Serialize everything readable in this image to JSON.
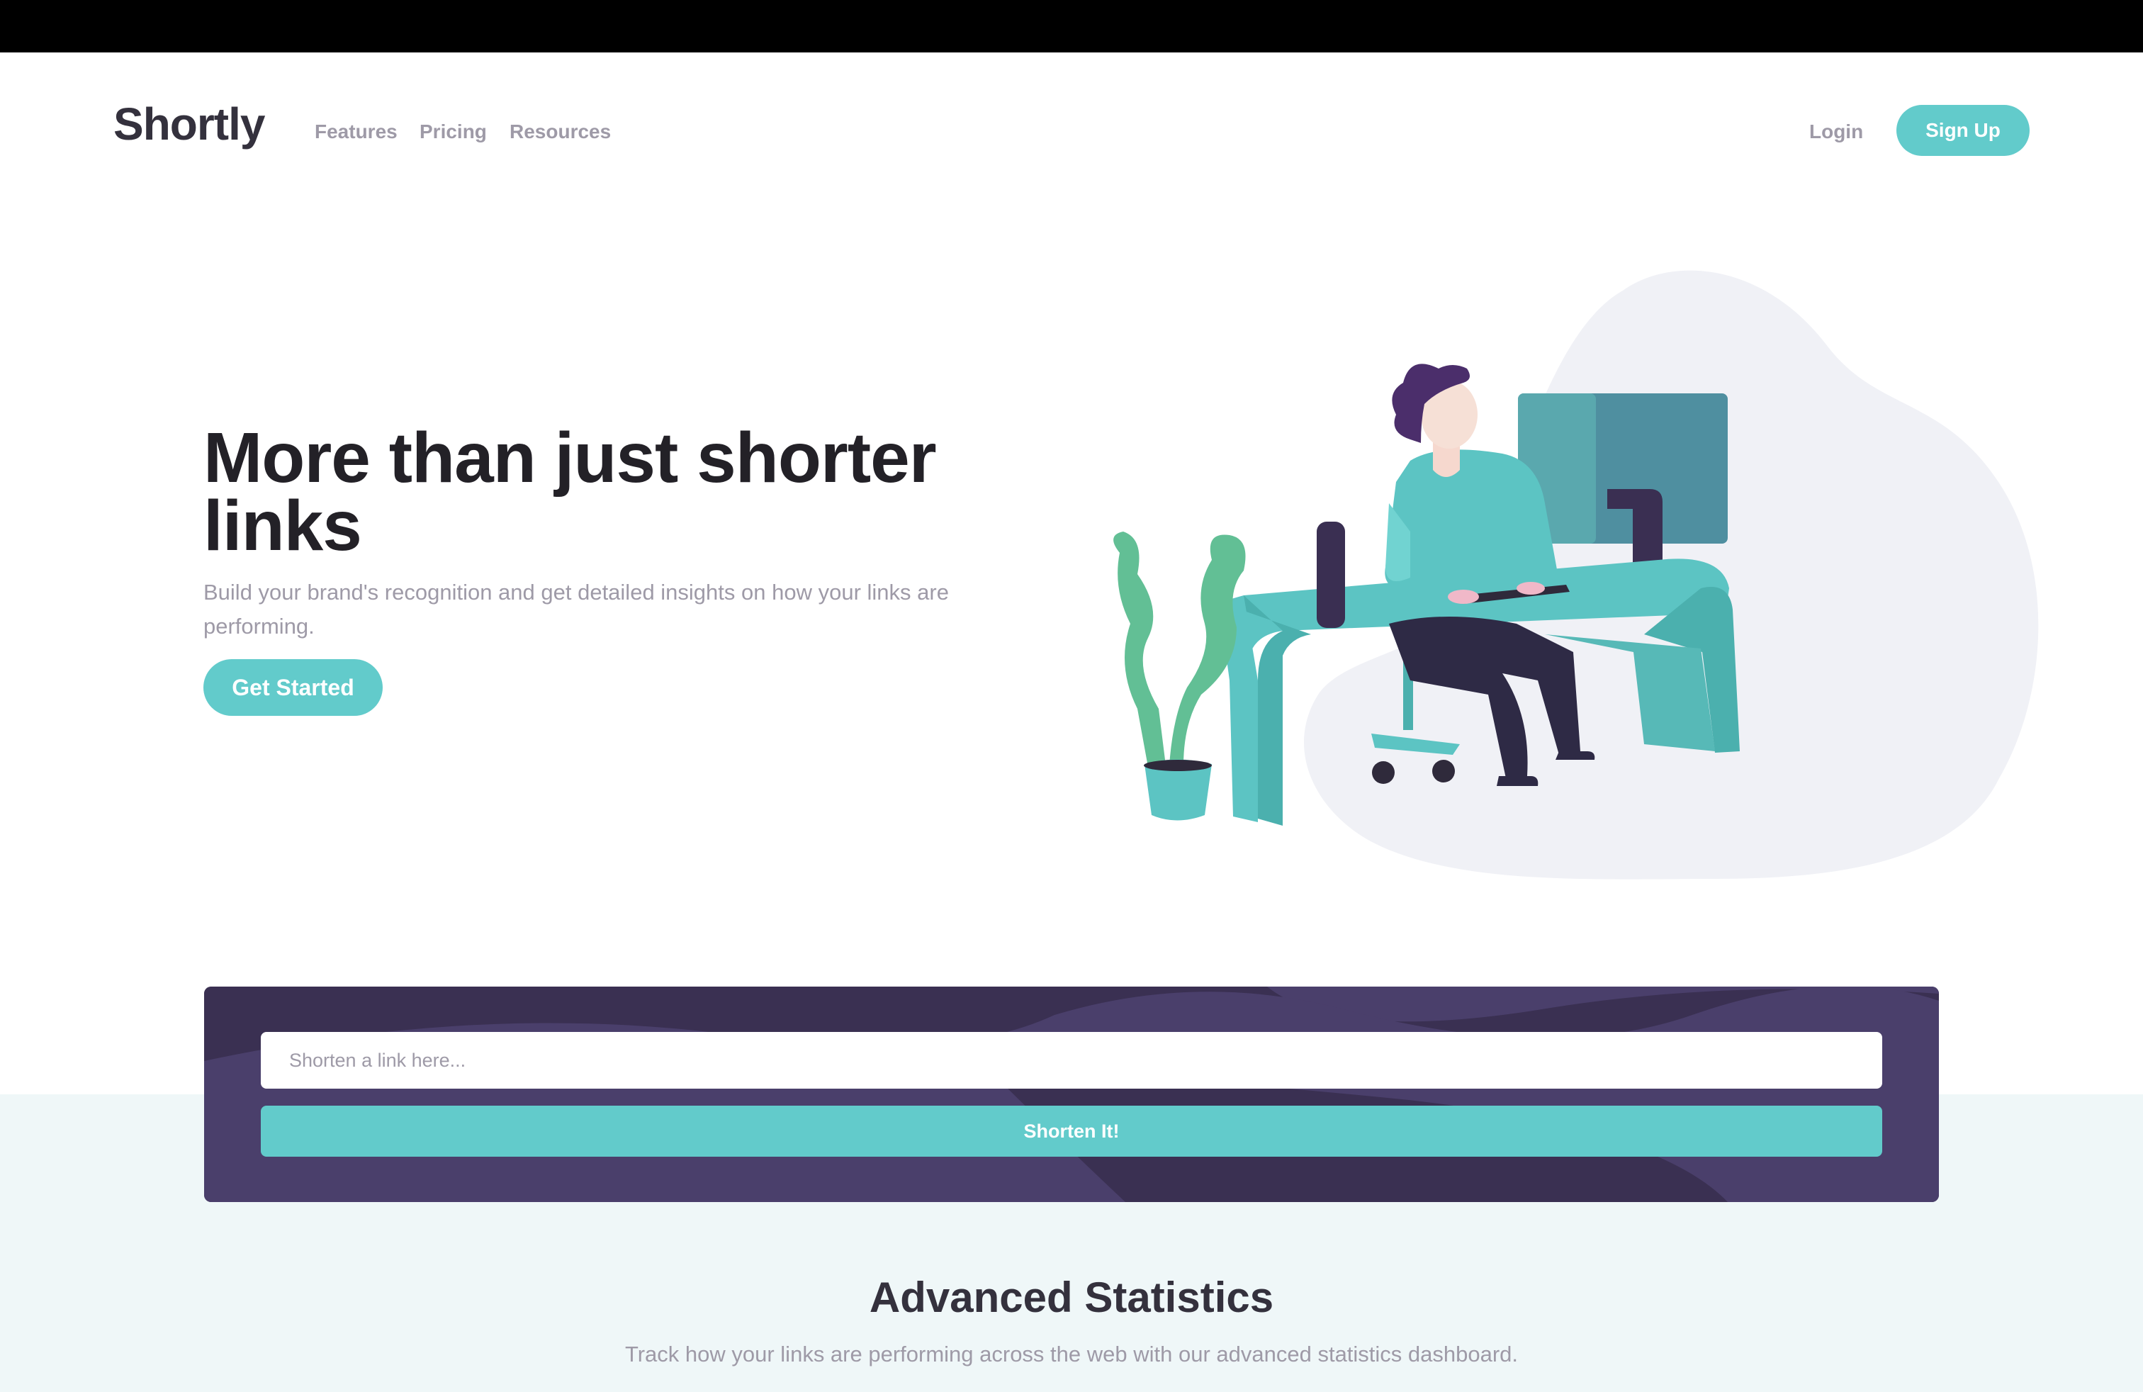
{
  "header": {
    "logo": "Shortly",
    "nav": {
      "features": "Features",
      "pricing": "Pricing",
      "resources": "Resources"
    },
    "login": "Login",
    "signup": "Sign Up"
  },
  "hero": {
    "title": "More than just shorter links",
    "subtitle": "Build your brand's recognition and get detailed insights on how your links are performing.",
    "cta": "Get Started",
    "illustration": "person-working-at-desk-illustration"
  },
  "shorten": {
    "placeholder": "Shorten a link here...",
    "button": "Shorten It!"
  },
  "statistics": {
    "title": "Advanced Statistics",
    "subtitle": "Track how your links are performing across the web with our advanced statistics dashboard."
  },
  "colors": {
    "primary_cyan": "#62cbcb",
    "dark_violet": "#3b3054",
    "very_dark_blue": "#232127",
    "grayish_violet": "#9e9aa7",
    "light_bg": "#eff7f8"
  }
}
